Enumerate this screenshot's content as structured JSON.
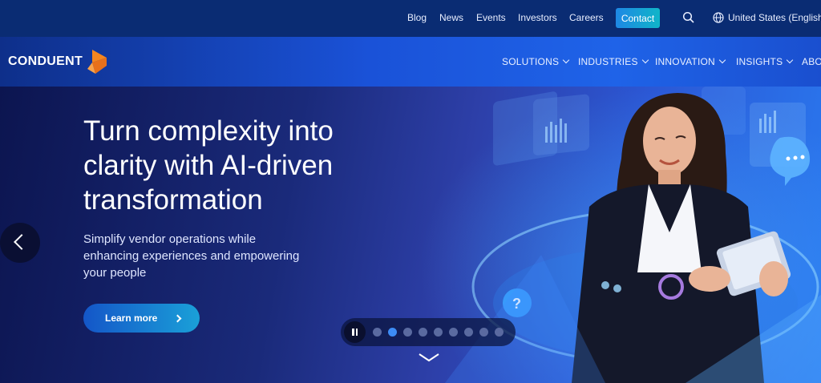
{
  "utility_nav": {
    "links": [
      "Blog",
      "News",
      "Events",
      "Investors",
      "Careers"
    ],
    "contact": "Contact",
    "region": "United States (English)"
  },
  "brand": {
    "name": "CONDUENT",
    "logo_color": "#f5861f"
  },
  "main_nav": {
    "items": [
      "SOLUTIONS",
      "INDUSTRIES",
      "INNOVATION",
      "INSIGHTS",
      "ABO"
    ]
  },
  "hero": {
    "title": "Turn complexity into clarity with AI-driven transformation",
    "subtitle": "Simplify vendor operations while enhancing experiences and empowering your people",
    "cta": "Learn more"
  },
  "carousel": {
    "slide_count": 9,
    "active_index": 1
  },
  "icons": {
    "search": "search-icon",
    "globe": "globe-icon",
    "prev": "chevron-left-icon",
    "next_cta": "chevron-right-icon",
    "pause": "pause-icon",
    "scroll": "chevron-down-icon"
  }
}
